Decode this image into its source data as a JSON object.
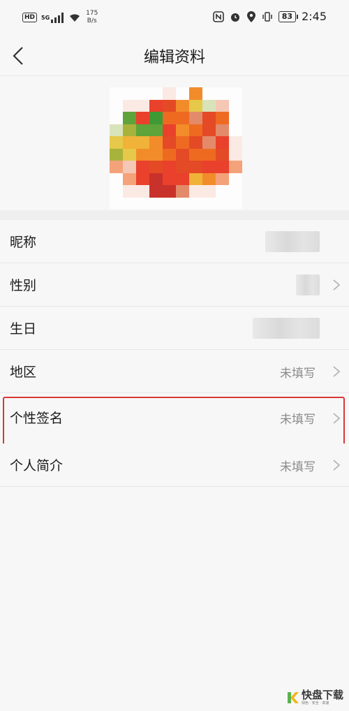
{
  "status_bar": {
    "hd_badge": "HD",
    "signal_label": "5G",
    "net_speed_value": "175",
    "net_speed_unit": "B/s",
    "battery": "83",
    "time": "2:45"
  },
  "header": {
    "title": "编辑资料"
  },
  "profile_rows": [
    {
      "label": "昵称",
      "value": ""
    },
    {
      "label": "性别",
      "value": ""
    },
    {
      "label": "生日",
      "value": ""
    },
    {
      "label": "地区",
      "value": "未填写"
    },
    {
      "label": "个性签名",
      "value": "未填写"
    },
    {
      "label": "个人简介",
      "value": "未填写"
    }
  ],
  "colors": {
    "highlight": "#d93636",
    "value_text": "#8a8a8a"
  },
  "watermark": {
    "main": "快盘下载",
    "sub": "绿色 · 安全 · 高速"
  }
}
